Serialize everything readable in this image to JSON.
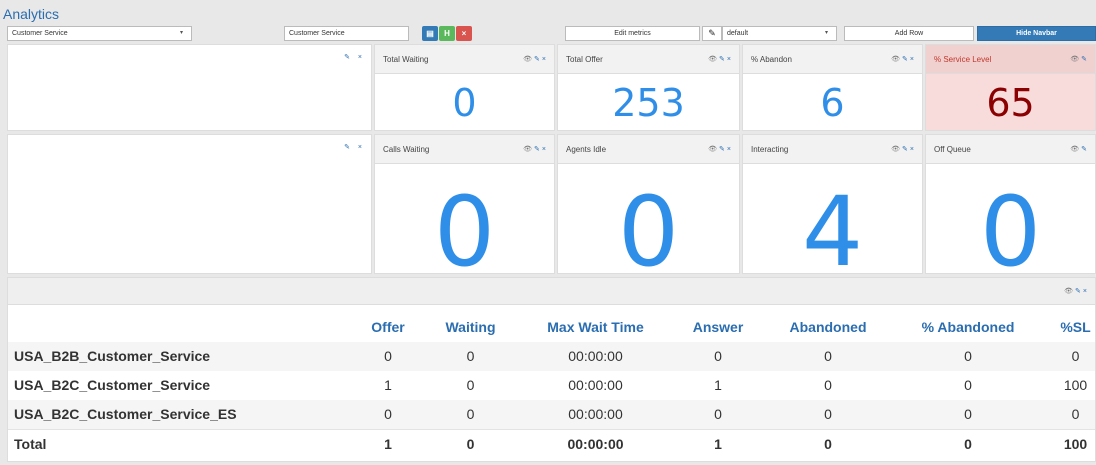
{
  "app": {
    "title": "Analytics"
  },
  "toolbar": {
    "queue_select": "Customer Service",
    "name_input": "Customer Service",
    "edit_metrics": "Edit metrics",
    "layout_select": "default",
    "add_row": "Add Row",
    "hide_navbar": "Hide Navbar",
    "caret": "▾",
    "pencil": "✎",
    "save_glyph": "▤",
    "green_glyph": "H",
    "close_glyph": "×"
  },
  "controls": {
    "eye": "👁",
    "wrench": "✎",
    "close": "×"
  },
  "metrics_row1": [
    {
      "label": "Total Waiting",
      "value": "0"
    },
    {
      "label": "Total Offer",
      "value": "253"
    },
    {
      "label": "% Abandon",
      "value": "6"
    },
    {
      "label": "% Service Level",
      "value": "65",
      "alert": true
    }
  ],
  "metrics_row2": [
    {
      "label": "Calls Waiting",
      "value": "0"
    },
    {
      "label": "Agents Idle",
      "value": "0"
    },
    {
      "label": "Interacting",
      "value": "4"
    },
    {
      "label": "Off Queue",
      "value": "0"
    }
  ],
  "queue_table": {
    "headers": [
      "Offer",
      "Waiting",
      "Max Wait Time",
      "Answer",
      "Abandoned",
      "% Abandoned",
      "%SL"
    ],
    "rows": [
      {
        "name": "USA_B2B_Customer_Service",
        "cells": [
          "0",
          "0",
          "00:00:00",
          "0",
          "0",
          "0",
          "0"
        ]
      },
      {
        "name": "USA_B2C_Customer_Service",
        "cells": [
          "1",
          "0",
          "00:00:00",
          "1",
          "0",
          "0",
          "100"
        ]
      },
      {
        "name": "USA_B2C_Customer_Service_ES",
        "cells": [
          "0",
          "0",
          "00:00:00",
          "0",
          "0",
          "0",
          "0"
        ]
      }
    ],
    "total": {
      "name": "Total",
      "cells": [
        "1",
        "0",
        "00:00:00",
        "1",
        "0",
        "0",
        "100"
      ]
    }
  },
  "colors": {
    "accent": "#2a6db0",
    "metric_value": "#2f8fe8",
    "alert_bg": "#f8dcdc",
    "alert_value": "#8b0000",
    "btn_save": "#337ab7",
    "btn_green": "#5cb85c",
    "btn_red": "#d9534f"
  }
}
